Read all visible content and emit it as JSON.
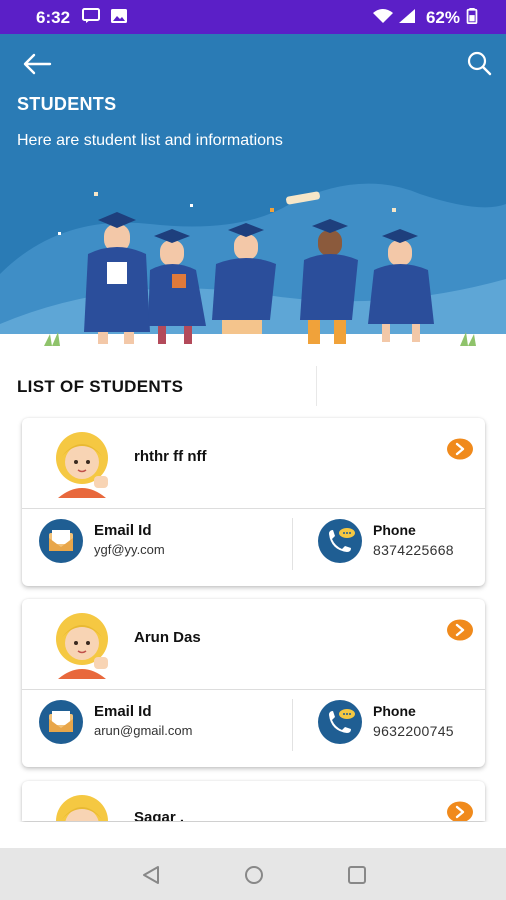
{
  "status_bar": {
    "time": "6:32",
    "battery": "62%",
    "icons": [
      "message-icon",
      "image-icon",
      "wifi-icon",
      "signal-icon",
      "battery-icon"
    ]
  },
  "header": {
    "title": "STUDENTS",
    "subtitle": "Here are student list and informations",
    "back_icon": "arrow-left-icon",
    "search_icon": "search-icon"
  },
  "list": {
    "title": "LIST OF STUDENTS",
    "students": [
      {
        "name": "rhthr ff nff",
        "email_label": "Email Id",
        "email": "ygf@yy.com",
        "phone_label": "Phone",
        "phone": "8374225668"
      },
      {
        "name": "Arun Das",
        "email_label": "Email Id",
        "email": "arun@gmail.com",
        "phone_label": "Phone",
        "phone": "9632200745"
      },
      {
        "name": "Sagar .",
        "email_label": "",
        "email": "",
        "phone_label": "",
        "phone": ""
      }
    ]
  },
  "colors": {
    "status_bar": "#5b1fc7",
    "header_bg": "#2a7bb5",
    "accent_orange": "#f08a1c",
    "icon_blue": "#1f5e93"
  },
  "nav_bar": {
    "icons": [
      "back-triangle-icon",
      "home-circle-icon",
      "recents-square-icon"
    ]
  }
}
